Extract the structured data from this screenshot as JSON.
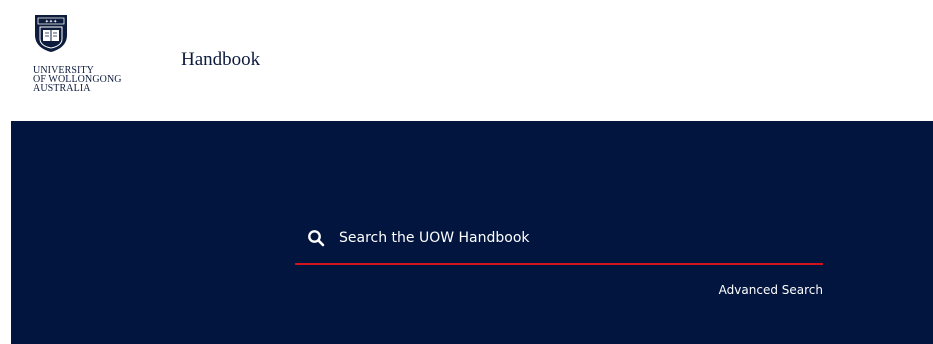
{
  "header": {
    "logo": {
      "line1": "UNIVERSITY",
      "line2": "OF WOLLONGONG",
      "line3": "AUSTRALIA",
      "icon": "uow-crest-icon"
    },
    "site_title": "Handbook"
  },
  "hero": {
    "background_color": "#02153f",
    "search": {
      "placeholder": "Search the UOW Handbook",
      "value": "",
      "icon": "search-icon",
      "underline_color": "#d3121f"
    },
    "advanced_search_label": "Advanced Search"
  }
}
